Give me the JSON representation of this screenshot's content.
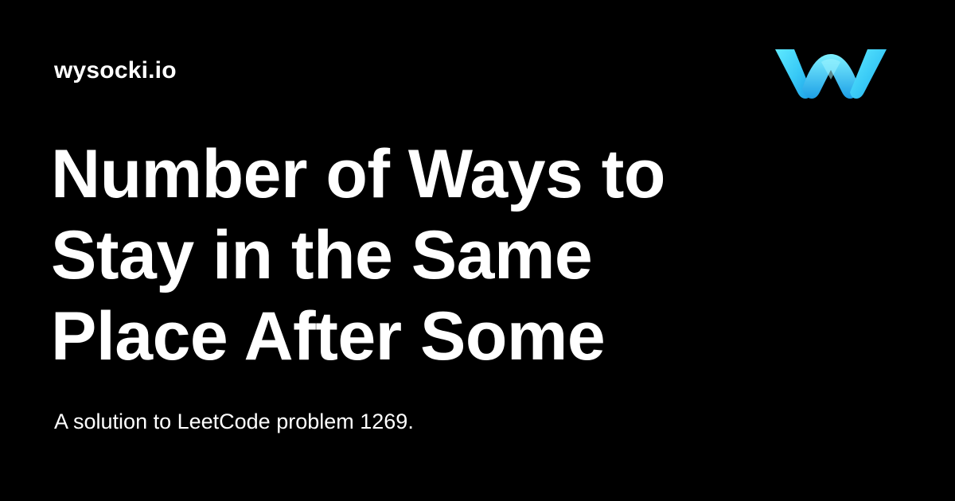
{
  "site": {
    "name": "wysocki.io"
  },
  "logo": {
    "icon": "wysocki-w-logo-icon",
    "colors": {
      "light": "#5fe9ff",
      "mid": "#38c9f6",
      "dark": "#1d9fe6"
    }
  },
  "article": {
    "title_lines": [
      "Number of Ways to",
      "Stay in the Same",
      "Place After Some"
    ],
    "subtitle": "A solution to LeetCode problem 1269."
  },
  "theme": {
    "background": "#000000",
    "text": "#ffffff"
  }
}
